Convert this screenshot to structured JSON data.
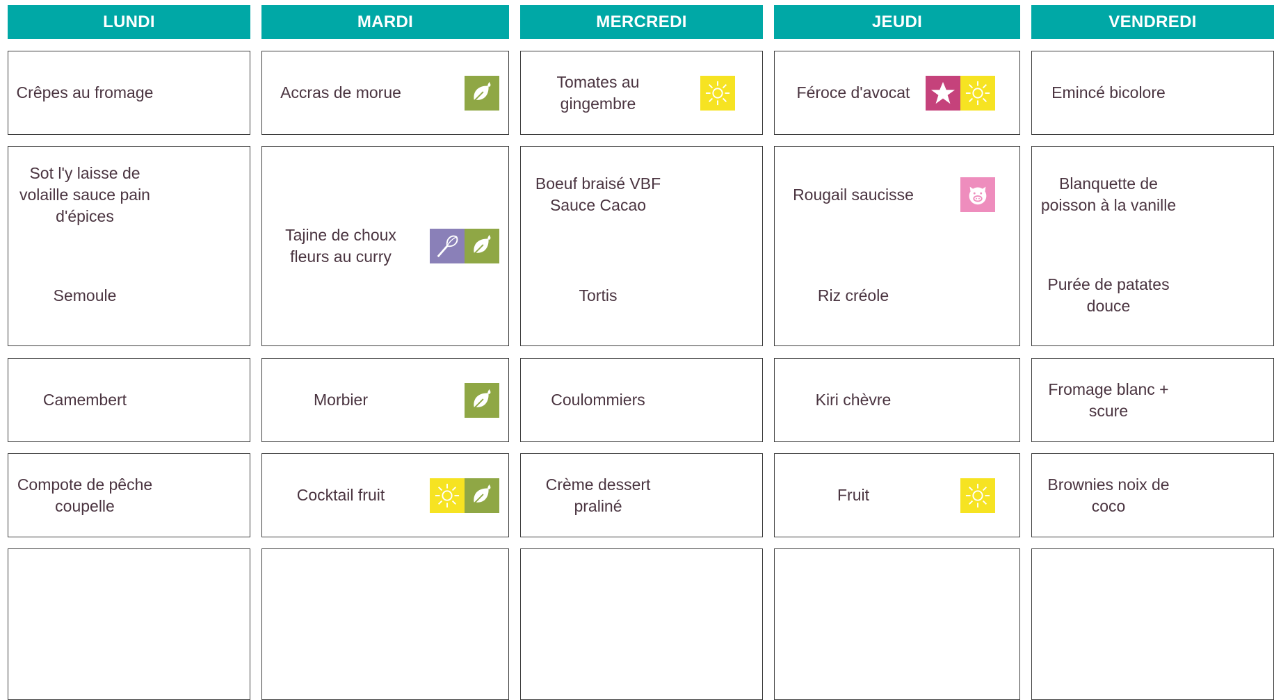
{
  "colors": {
    "header": "#00a8a6",
    "leaf": "#8fa745",
    "sun": "#f6e322",
    "star": "#c5427b",
    "whisk": "#8a80b8",
    "pig": "#ee8dbd"
  },
  "days": [
    {
      "name": "LUNDI",
      "rows": [
        {
          "items": [
            {
              "text": "Crêpes au fromage",
              "icons": []
            }
          ]
        },
        {
          "items": [
            {
              "text": "Sot l'y laisse de volaille sauce pain d'épices",
              "icons": []
            },
            {
              "text": "Semoule",
              "icons": []
            }
          ]
        },
        {
          "items": [
            {
              "text": "Camembert",
              "icons": []
            }
          ]
        },
        {
          "items": [
            {
              "text": "Compote de pêche coupelle",
              "icons": []
            }
          ]
        },
        {
          "items": []
        }
      ]
    },
    {
      "name": "MARDI",
      "rows": [
        {
          "items": [
            {
              "text": "Accras de morue",
              "icons": [
                "leaf-icon"
              ]
            }
          ]
        },
        {
          "items": [
            {
              "text": "Tajine de choux fleurs au curry",
              "icons": [
                "whisk-icon",
                "leaf-icon"
              ]
            }
          ]
        },
        {
          "items": [
            {
              "text": "Morbier",
              "icons": [
                "leaf-icon"
              ]
            }
          ]
        },
        {
          "items": [
            {
              "text": "Cocktail fruit",
              "icons": [
                "sun-icon",
                "leaf-icon"
              ]
            }
          ]
        },
        {
          "items": []
        }
      ]
    },
    {
      "name": "MERCREDI",
      "rows": [
        {
          "items": [
            {
              "text": "Tomates au gingembre",
              "icons": [
                "sun-icon"
              ]
            }
          ]
        },
        {
          "items": [
            {
              "text": "Boeuf braisé VBF Sauce Cacao",
              "icons": []
            },
            {
              "text": "Tortis",
              "icons": []
            }
          ]
        },
        {
          "items": [
            {
              "text": "Coulommiers",
              "icons": []
            }
          ]
        },
        {
          "items": [
            {
              "text": "Crème dessert praliné",
              "icons": []
            }
          ]
        },
        {
          "items": []
        }
      ]
    },
    {
      "name": "JEUDI",
      "rows": [
        {
          "items": [
            {
              "text": "Féroce d'avocat",
              "icons": [
                "star-icon",
                "sun-icon"
              ]
            }
          ]
        },
        {
          "items": [
            {
              "text": "Rougail saucisse",
              "icons": [
                "pig-icon"
              ]
            },
            {
              "text": "Riz créole",
              "icons": []
            }
          ]
        },
        {
          "items": [
            {
              "text": "Kiri chèvre",
              "icons": []
            }
          ]
        },
        {
          "items": [
            {
              "text": "Fruit",
              "icons": [
                "sun-icon"
              ]
            }
          ]
        },
        {
          "items": []
        }
      ]
    },
    {
      "name": "VENDREDI",
      "rows": [
        {
          "items": [
            {
              "text": "Emincé bicolore",
              "icons": []
            }
          ]
        },
        {
          "items": [
            {
              "text": "Blanquette de poisson à la vanille",
              "icons": []
            },
            {
              "text": "Purée de patates douce",
              "icons": []
            }
          ]
        },
        {
          "items": [
            {
              "text": "Fromage blanc + scure",
              "icons": []
            }
          ]
        },
        {
          "items": [
            {
              "text": "Brownies noix de coco",
              "icons": []
            }
          ]
        },
        {
          "items": []
        }
      ]
    }
  ]
}
